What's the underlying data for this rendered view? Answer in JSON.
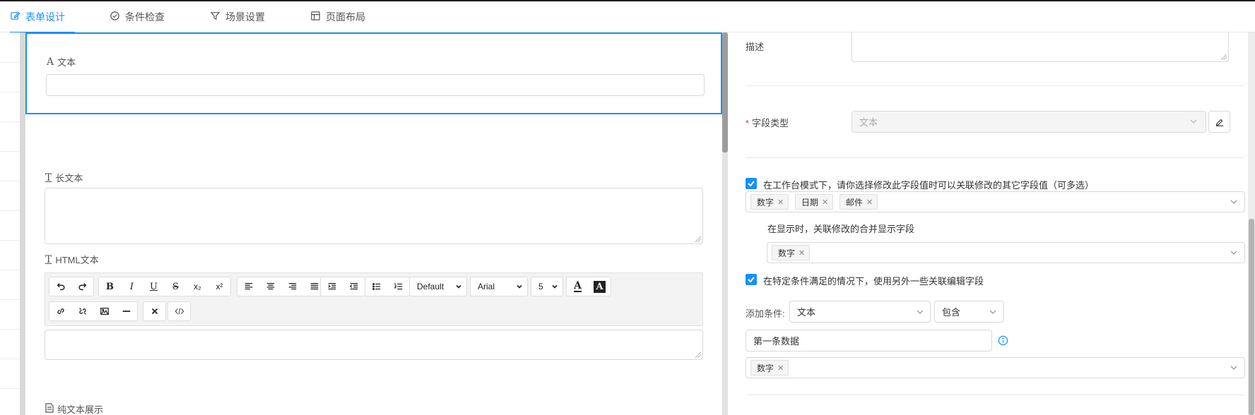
{
  "tabs": [
    {
      "label": "表单设计",
      "icon": "edit-icon",
      "active": true
    },
    {
      "label": "条件检查",
      "icon": "check-circle-icon",
      "active": false
    },
    {
      "label": "场景设置",
      "icon": "funnel-icon",
      "active": false
    },
    {
      "label": "页面布局",
      "icon": "layout-icon",
      "active": false
    }
  ],
  "form": {
    "fields": [
      {
        "icon": "A",
        "label": "文本",
        "type": "text"
      },
      {
        "icon": "T",
        "label": "长文本",
        "type": "textarea"
      },
      {
        "icon": "T",
        "label": "HTML文本",
        "type": "richtext"
      },
      {
        "icon": "doc-icon",
        "label": "纯文本展示",
        "type": "static"
      }
    ],
    "editor": {
      "format_select": "Default",
      "font_select": "Arial",
      "size_select": "5",
      "bold": "B",
      "italic": "I",
      "underline": "U",
      "strike": "S",
      "subscript": "x₂",
      "superscript": "x²"
    }
  },
  "properties": {
    "description_label": "描述",
    "field_type_label": "字段类型",
    "field_type_value": "文本",
    "workbench_checkbox_label": "在工作台模式下，请你选择修改此字段值时可以关联修改的其它字段值（可多选）",
    "linked_tags": [
      "数字",
      "日期",
      "邮件"
    ],
    "merge_display_label": "在显示时，关联修改的合并显示字段",
    "merge_tags": [
      "数字"
    ],
    "condition_checkbox_label": "在特定条件满足的情况下，使用另外一些关联编辑字段",
    "add_condition_label": "添加条件:",
    "condition_field": "文本",
    "condition_operator": "包含",
    "condition_value": "第一条数据",
    "condition_tags": [
      "数字"
    ]
  },
  "colors": {
    "accent": "#1890ff",
    "required": "#f5222d"
  }
}
